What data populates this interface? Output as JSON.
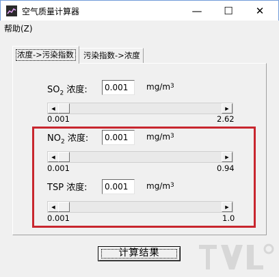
{
  "window": {
    "title": "空气质量计算器",
    "minimize_glyph": "—",
    "maximize_glyph": "☐",
    "close_glyph": "✕"
  },
  "menu": {
    "help": "帮助(Z)"
  },
  "tabs": [
    {
      "label": "浓度->污染指数",
      "active": true
    },
    {
      "label": "污染指数->浓度",
      "active": false
    }
  ],
  "pollutants": [
    {
      "name": "SO",
      "sub": "2",
      "suffix": " 浓度:",
      "value": "0.001",
      "unit": "mg/m",
      "unit_sup": "3",
      "min": "0.001",
      "max": "2.62",
      "slider_fraction": 0.0
    },
    {
      "name": "NO",
      "sub": "2",
      "suffix": " 浓度:",
      "value": "0.001",
      "unit": "mg/m",
      "unit_sup": "3",
      "min": "0.001",
      "max": "0.94",
      "slider_fraction": 0.0
    },
    {
      "name": "TSP",
      "sub": "",
      "suffix": " 浓度:",
      "value": "0.001",
      "unit": "mg/m",
      "unit_sup": "3",
      "min": "0.001",
      "max": "1.0",
      "slider_fraction": 0.0
    }
  ],
  "actions": {
    "calculate": "计算结果"
  },
  "colors": {
    "highlight": "#c8262e",
    "title_border": "#6f9ad9"
  },
  "icons": {
    "app": "chart-line-icon",
    "scroll_left": "triangle-left",
    "scroll_right": "triangle-right"
  }
}
